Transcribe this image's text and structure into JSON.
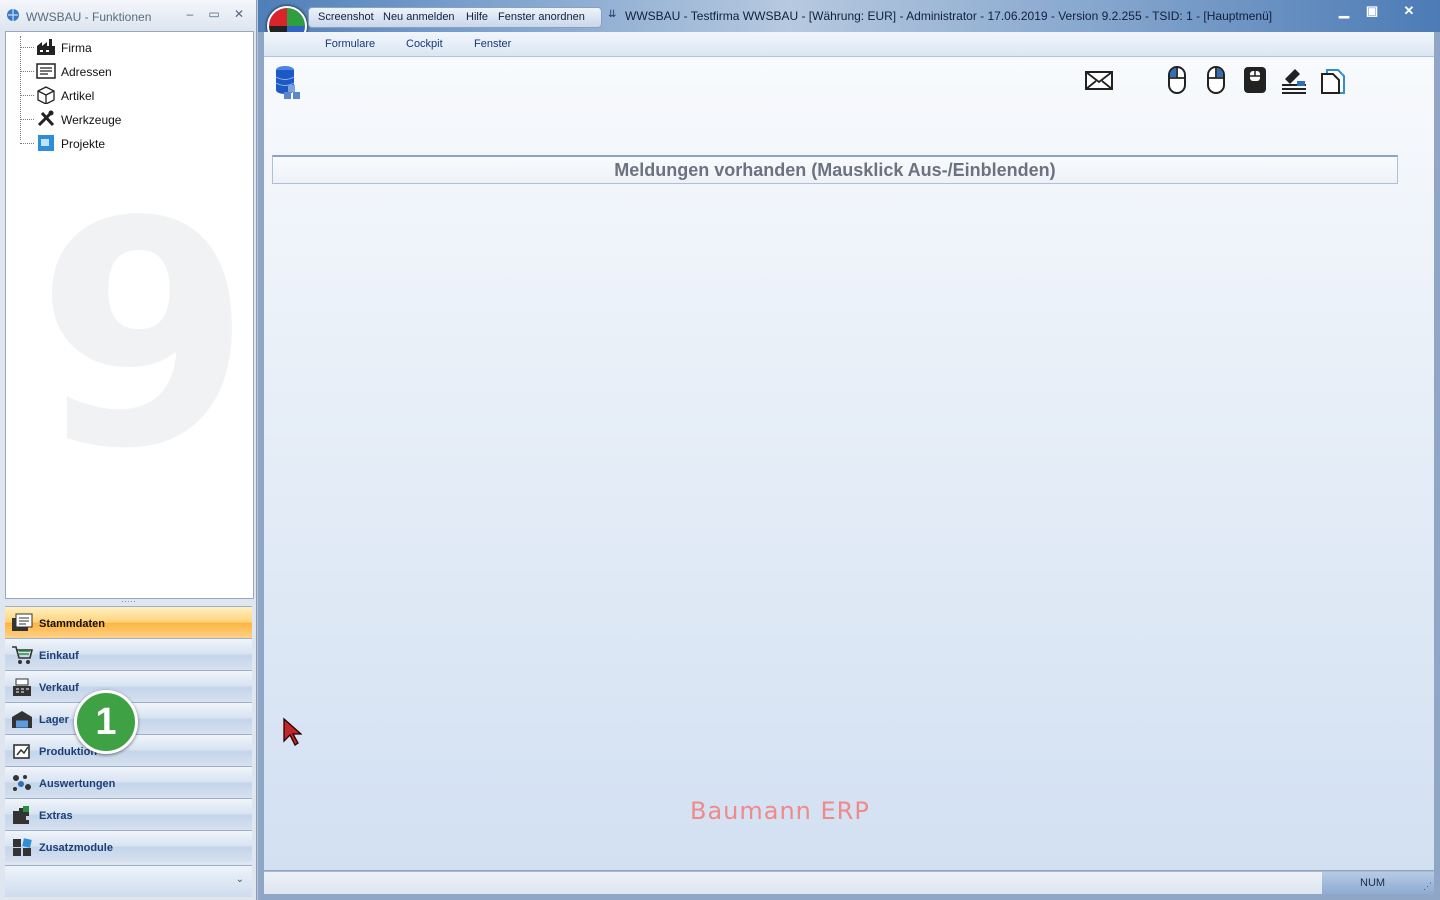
{
  "left_window": {
    "title": "WWSBAU - Funktionen",
    "min_glyph": "–",
    "max_glyph": "▭",
    "close_glyph": "✕",
    "tree": [
      {
        "label": "Firma",
        "icon": "factory-icon"
      },
      {
        "label": "Adressen",
        "icon": "address-card-icon"
      },
      {
        "label": "Artikel",
        "icon": "box-icon"
      },
      {
        "label": "Werkzeuge",
        "icon": "tools-icon"
      },
      {
        "label": "Projekte",
        "icon": "project-icon"
      }
    ],
    "watermark": "9",
    "splitter_glyph": "·····",
    "nav": [
      {
        "label": "Stammdaten",
        "icon": "master-data-icon",
        "active": true
      },
      {
        "label": "Einkauf",
        "icon": "shopping-cart-icon"
      },
      {
        "label": "Verkauf",
        "icon": "cash-register-icon"
      },
      {
        "label": "Lager",
        "icon": "warehouse-icon"
      },
      {
        "label": "Produktion",
        "icon": "production-icon"
      },
      {
        "label": "Auswertungen",
        "icon": "analytics-icon"
      },
      {
        "label": "Extras",
        "icon": "puzzle-icon"
      },
      {
        "label": "Zusatzmodule",
        "icon": "modules-icon"
      }
    ],
    "footer_chevron": "⌄"
  },
  "badge": {
    "number": "1",
    "color": "#3ea244"
  },
  "main_window": {
    "quick_access": [
      "Screenshot",
      "Neu anmelden",
      "Hilfe",
      "Fenster anordnen"
    ],
    "qat_dropdown_glyph": "⇊",
    "title": "WWSBAU - Testfirma WWSBAU - [Währung: EUR] - Administrator - 17.06.2019 - Version 9.2.255 - TSID: 1  - [Hauptmenü]",
    "min_glyph": "▁",
    "max_glyph": "▣",
    "close_glyph": "✕",
    "menu": [
      "Formulare",
      "Cockpit",
      "Fenster"
    ],
    "toolbar_icons": [
      "mail-icon",
      "mouse-left-icon",
      "mouse-right-icon",
      "mouse-dark-icon",
      "network-icon",
      "document-copy-icon"
    ],
    "message_bar": "Meldungen vorhanden  (Mausklick Aus-/Einblenden)",
    "brand": "Baumann ERP",
    "status": {
      "num": "NUM",
      "grip": "⋰"
    }
  },
  "colors": {
    "active_nav": "#ffb43d",
    "nav_text": "#1d3f78",
    "brand_text": "#f08a8a",
    "title_bar": "#4f7fb7"
  }
}
